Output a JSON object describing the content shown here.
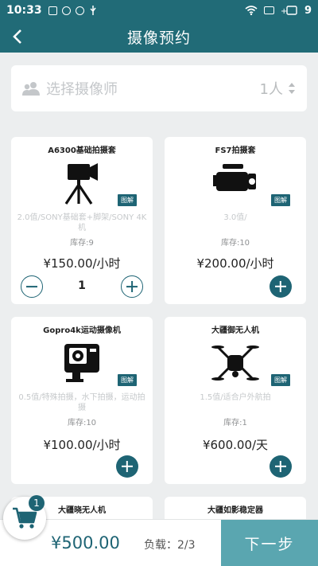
{
  "status_bar": {
    "time": "10:33",
    "battery": "9"
  },
  "header": {
    "title": "摄像预约"
  },
  "photographer_picker": {
    "placeholder": "选择摄像师",
    "count": "1人"
  },
  "cards": [
    {
      "name": "A6300基础拍摄套",
      "tag": "图解",
      "desc": "2.0值/SONY基础套+脚架/SONY 4K机",
      "stock": "库存:9",
      "price": "¥150.00/小时",
      "quantity": "1"
    },
    {
      "name": "FS7拍摄套",
      "tag": "图解",
      "desc": "3.0值/",
      "stock": "库存:10",
      "price": "¥200.00/小时"
    },
    {
      "name": "Gopro4k运动摄像机",
      "tag": "图解",
      "desc": "0.5值/特殊拍摄，水下拍摄，运动拍摄",
      "stock": "库存:10",
      "price": "¥100.00/小时"
    },
    {
      "name": "大疆御无人机",
      "tag": "图解",
      "desc": "1.5值/适合户外航拍",
      "stock": "库存:1",
      "price": "¥600.00/天"
    },
    {
      "name": "大疆晓无人机"
    },
    {
      "name": "大疆如影稳定器"
    }
  ],
  "cart": {
    "badge": "1"
  },
  "footer": {
    "total": "¥500.00",
    "load": "负载：2/3",
    "next_label": "下一步"
  },
  "colors": {
    "header_bg": "#216b77",
    "accent": "#1e6474",
    "next_button": "#5aa6b0",
    "page_bg": "#eceeef"
  }
}
